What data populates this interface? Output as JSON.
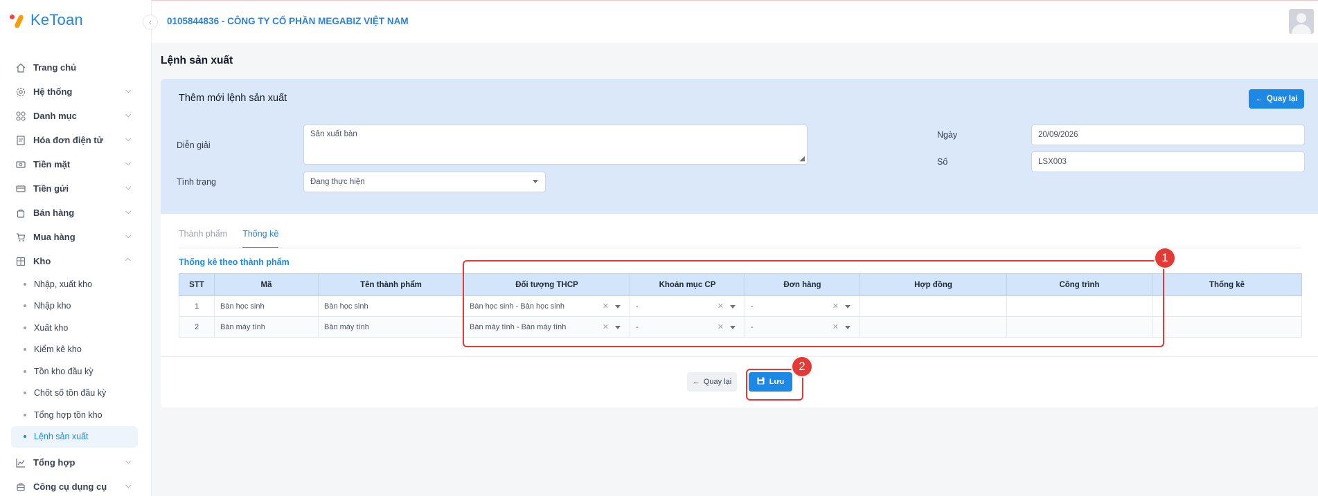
{
  "app": {
    "logo_text": "KeToan",
    "company": "0105844836 - CÔNG TY CỔ PHẦN MEGABIZ VIỆT NAM"
  },
  "sidebar": {
    "items": [
      {
        "label": "Trang chủ",
        "icon": "home-icon"
      },
      {
        "label": "Hệ thống",
        "icon": "gear-icon"
      },
      {
        "label": "Danh mục",
        "icon": "grid-icon"
      },
      {
        "label": "Hóa đơn điện tử",
        "icon": "invoice-icon"
      },
      {
        "label": "Tiền mặt",
        "icon": "cash-icon"
      },
      {
        "label": "Tiền gửi",
        "icon": "card-icon"
      },
      {
        "label": "Bán hàng",
        "icon": "bag-icon"
      },
      {
        "label": "Mua hàng",
        "icon": "cart-icon"
      },
      {
        "label": "Kho",
        "icon": "warehouse-icon"
      }
    ],
    "kho_sub": [
      "Nhập, xuất kho",
      "Nhập kho",
      "Xuất kho",
      "Kiểm kê kho",
      "Tồn kho đầu kỳ",
      "Chốt số tồn đầu kỳ",
      "Tổng hợp tồn kho",
      "Lệnh sản xuất"
    ],
    "bottom_items": [
      {
        "label": "Tổng hợp",
        "icon": "chart-icon"
      },
      {
        "label": "Công cụ dụng cụ",
        "icon": "tools-icon"
      }
    ]
  },
  "page": {
    "title": "Lệnh sản xuất"
  },
  "form": {
    "title": "Thêm mới lệnh sản xuất",
    "back_top_label": "Quay lại",
    "dien_giai_label": "Diễn giải",
    "dien_giai_value": "Sản xuất bàn",
    "tinh_trang_label": "Tình trạng",
    "tinh_trang_value": "Đang thực hiện",
    "ngay_label": "Ngày",
    "ngay_value": "20/09/2026",
    "so_label": "Số",
    "so_value": "LSX003"
  },
  "tabs": [
    "Thành phẩm",
    "Thống kê"
  ],
  "section_title": "Thống kê theo thành phẩm",
  "table": {
    "headers": [
      "STT",
      "Mã",
      "Tên thành phẩm",
      "Đối tượng THCP",
      "Khoản mục CP",
      "Đơn hàng",
      "Hợp đồng",
      "Công trình",
      "Thống kê"
    ],
    "rows": [
      {
        "stt": "1",
        "ma": "Bàn học sinh",
        "ten": "Bàn học sinh",
        "doi_tuong": "Bàn học sinh - Bàn học sinh",
        "khoan_muc": "-",
        "don_hang": "-"
      },
      {
        "stt": "2",
        "ma": "Bàn máy tính",
        "ten": "Bàn máy tính",
        "doi_tuong": "Bàn máy tính - Bàn máy tính",
        "khoan_muc": "-",
        "don_hang": "-"
      }
    ]
  },
  "footer": {
    "back_label": "Quay lại",
    "save_label": "Lưu"
  },
  "annotations": [
    "1",
    "2"
  ],
  "colors": {
    "accent": "#1e88e5",
    "highlight": "#e53935"
  }
}
